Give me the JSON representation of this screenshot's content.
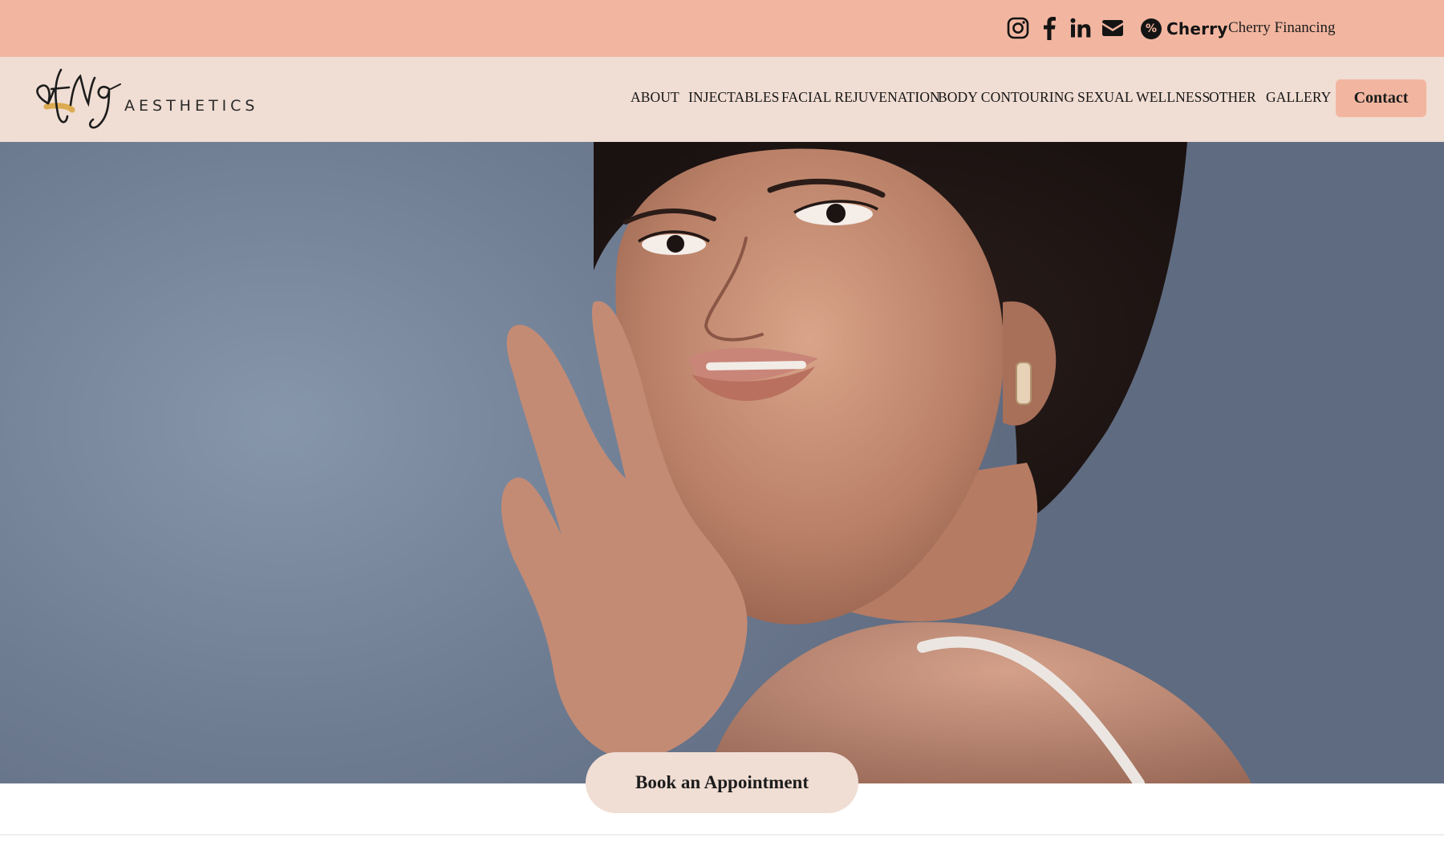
{
  "topbar": {
    "icons": [
      "instagram-icon",
      "facebook-icon",
      "linkedin-icon",
      "email-icon"
    ],
    "cherry_brand": "Cherry",
    "cherry_link": "Cherry Financing",
    "color": "#f2b6a0"
  },
  "header": {
    "logo_script": "afng",
    "logo_word": "AESTHETICS",
    "nav": [
      "ABOUT",
      "INJECTABLES",
      "FACIAL REJUVENATION",
      "BODY CONTOURING",
      "SEXUAL WELLNESS",
      "OTHER",
      "GALLERY"
    ],
    "contact_label": "Contact",
    "color": "#f0ddd3"
  },
  "hero": {
    "image": "portrait-woman-touching-face"
  },
  "cta": {
    "book_label": "Book an Appointment"
  }
}
